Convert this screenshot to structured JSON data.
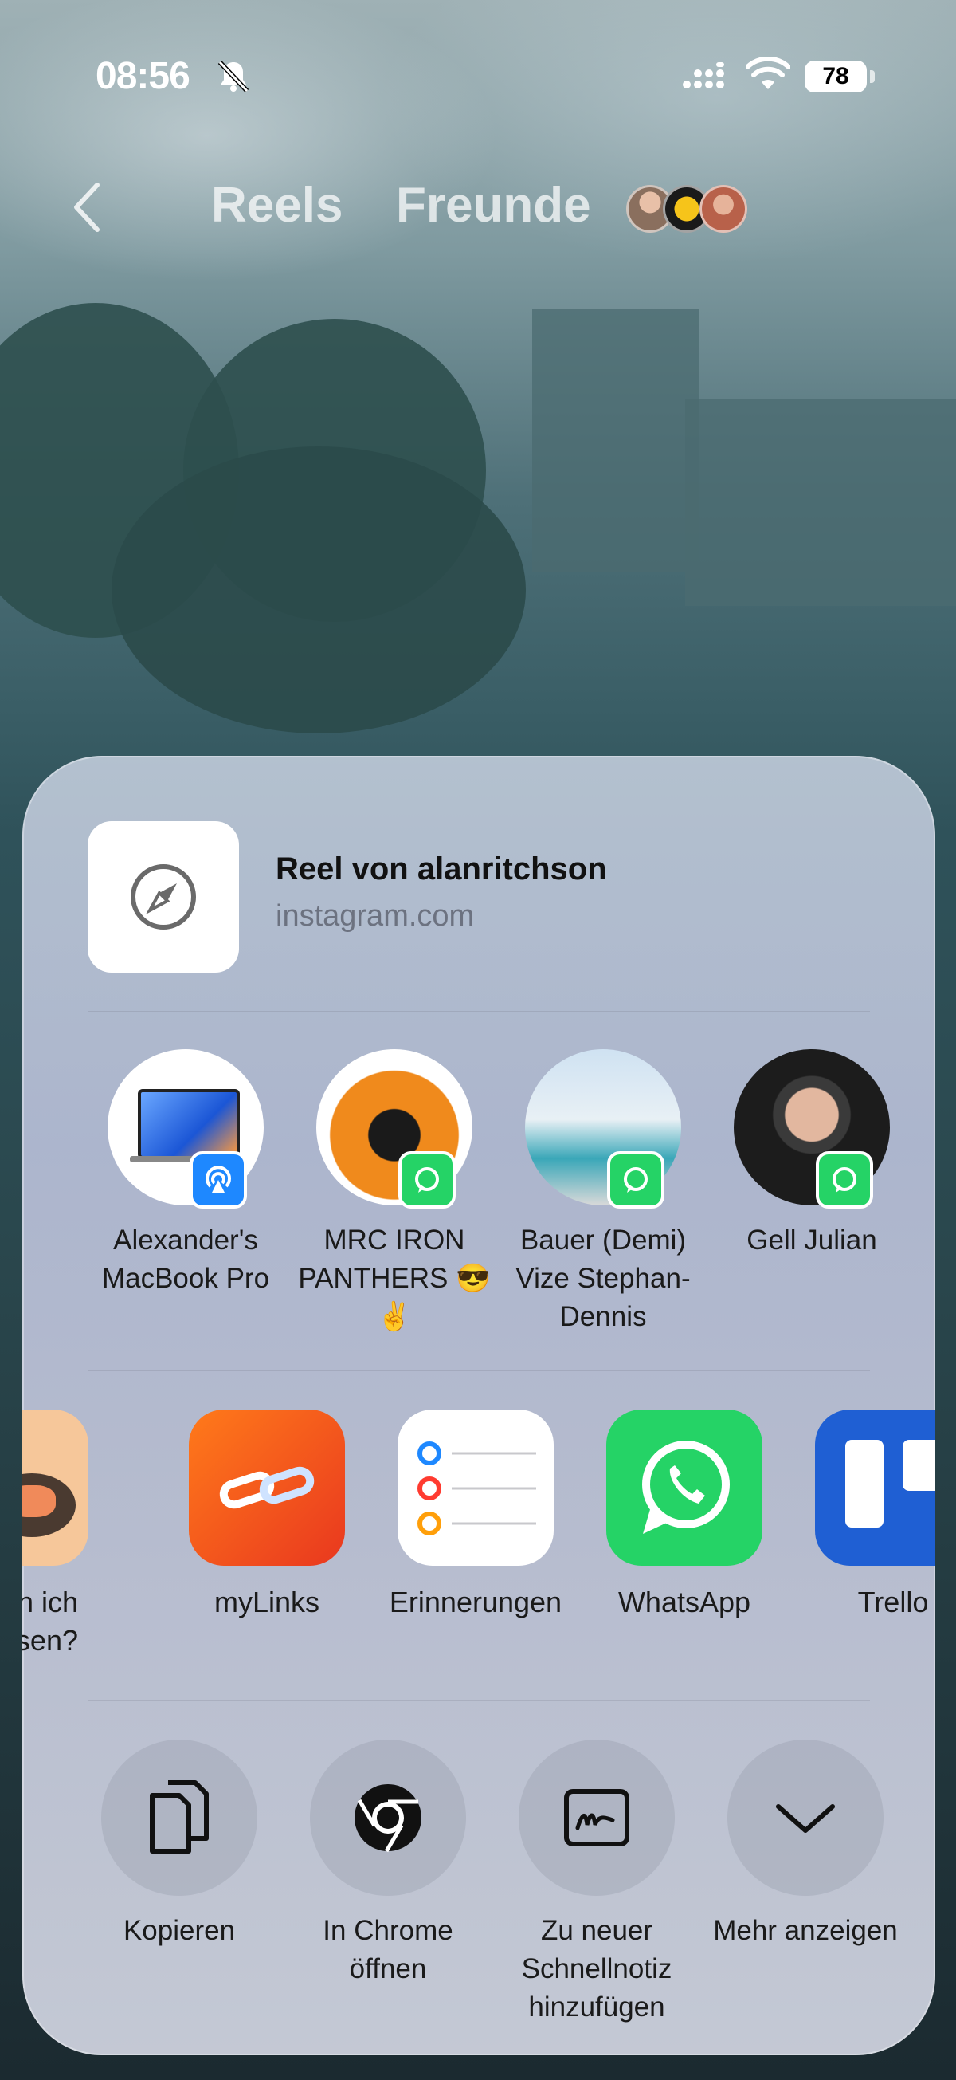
{
  "status": {
    "time": "08:56",
    "battery": "78"
  },
  "nav": {
    "tab_reels": "Reels",
    "tab_friends": "Freunde"
  },
  "share": {
    "title": "Reel von alanritchson",
    "url": "instagram.com",
    "people": [
      {
        "name": "Alexander's MacBook Pro",
        "badge": "airdrop-icon"
      },
      {
        "name": "MRC IRON PANTHERS 😎✌️",
        "badge": "whatsapp-icon"
      },
      {
        "name": "Bauer (Demi) Vize Stephan-Dennis",
        "badge": "whatsapp-icon"
      },
      {
        "name": "Gell Julian",
        "badge": "whatsapp-icon"
      }
    ],
    "apps": [
      {
        "name": "kann ich\nsen?"
      },
      {
        "name": "myLinks"
      },
      {
        "name": "Erinnerungen"
      },
      {
        "name": "WhatsApp"
      },
      {
        "name": "Trello"
      }
    ],
    "actions": [
      {
        "name": "Kopieren"
      },
      {
        "name": "In Chrome öffnen"
      },
      {
        "name": "Zu neuer Schnellnotiz hinzufügen"
      },
      {
        "name": "Mehr anzeigen"
      }
    ]
  },
  "colors": {
    "whatsapp": "#25D366",
    "airdrop": "#1e88ff",
    "trello": "#1f5fd3",
    "mylinks": "#ff5a1f"
  }
}
